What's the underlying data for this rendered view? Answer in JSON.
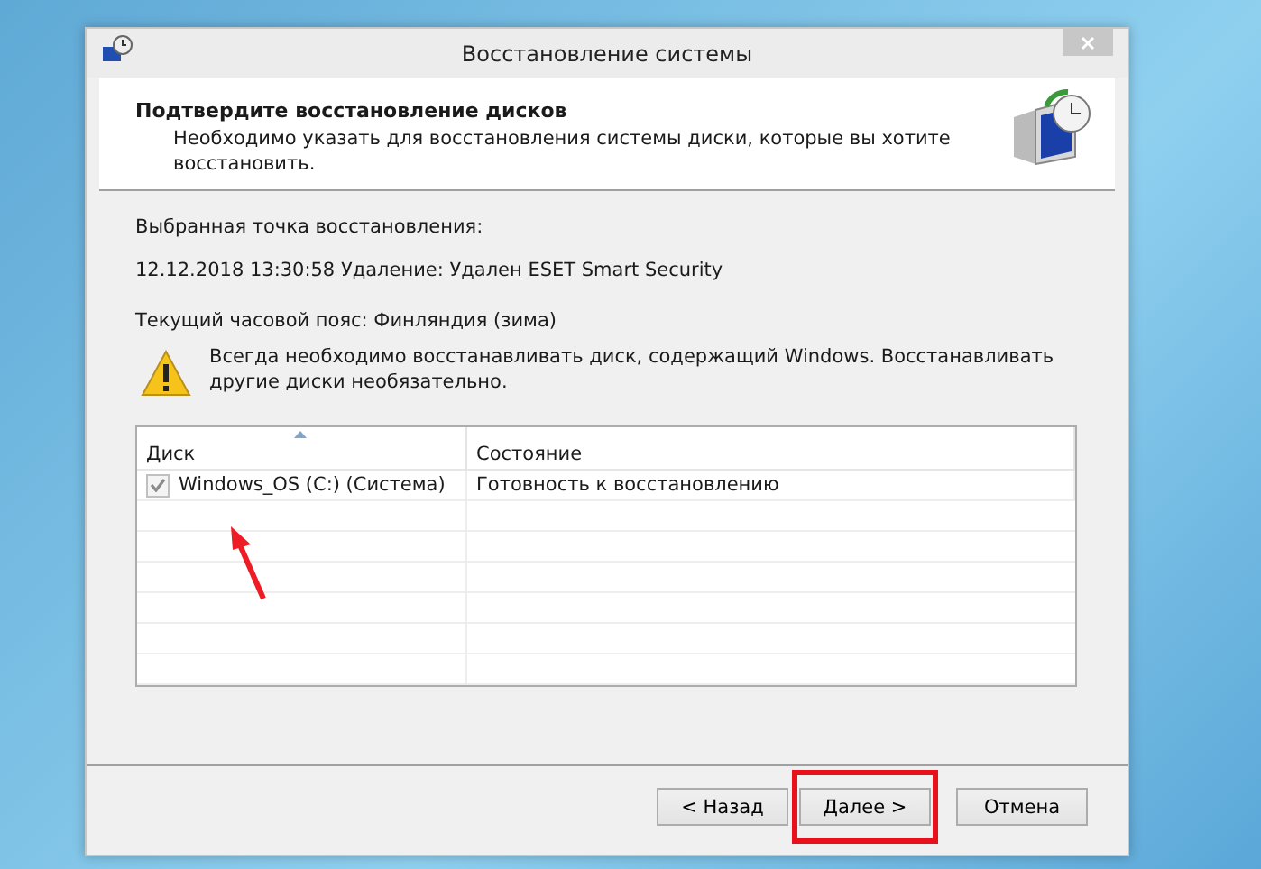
{
  "window": {
    "title": "Восстановление системы"
  },
  "header": {
    "title": "Подтвердите восстановление дисков",
    "subtitle": "Необходимо указать для восстановления системы диски, которые вы хотите восстановить."
  },
  "restore_point": {
    "label": "Выбранная точка восстановления:",
    "value": "12.12.2018 13:30:58 Удаление: Удален ESET Smart Security"
  },
  "timezone": "Текущий часовой пояс: Финляндия (зима)",
  "warning": "Всегда необходимо восстанавливать диск, содержащий Windows. Восстанавливать другие диски необязательно.",
  "table": {
    "columns": [
      "Диск",
      "Состояние"
    ],
    "rows": [
      {
        "disk": "Windows_OS (C:) (Система)",
        "status": "Готовность к восстановлению",
        "checked": true,
        "disabled": true
      }
    ]
  },
  "buttons": [
    {
      "label": "< Назад",
      "highlighted": false
    },
    {
      "label": "Далее >",
      "highlighted": true
    },
    {
      "label": "Отмена",
      "highlighted": false
    }
  ]
}
